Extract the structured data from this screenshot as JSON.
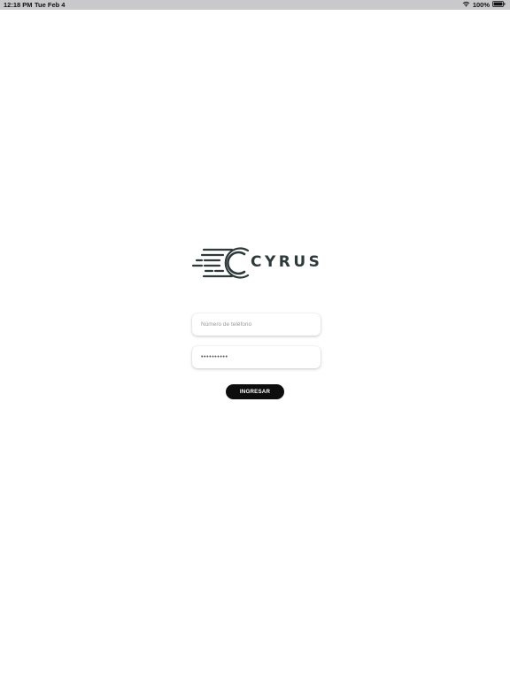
{
  "status_bar": {
    "time": "12:18 PM",
    "date": "Tue Feb 4",
    "battery_percent": "100%",
    "icons": [
      "wifi-icon",
      "battery-icon"
    ]
  },
  "logo": {
    "text": "CYRUS",
    "color": "#2e3a3a"
  },
  "form": {
    "phone": {
      "placeholder": "Número de teléfono",
      "value": ""
    },
    "password": {
      "placeholder": "",
      "value": "••••••••••"
    },
    "submit_label": "INGRESAR"
  },
  "colors": {
    "background": "#ffffff",
    "status_bar": "#c9c9cc",
    "button": "#0d0d0d",
    "button_text": "#ffffff"
  }
}
